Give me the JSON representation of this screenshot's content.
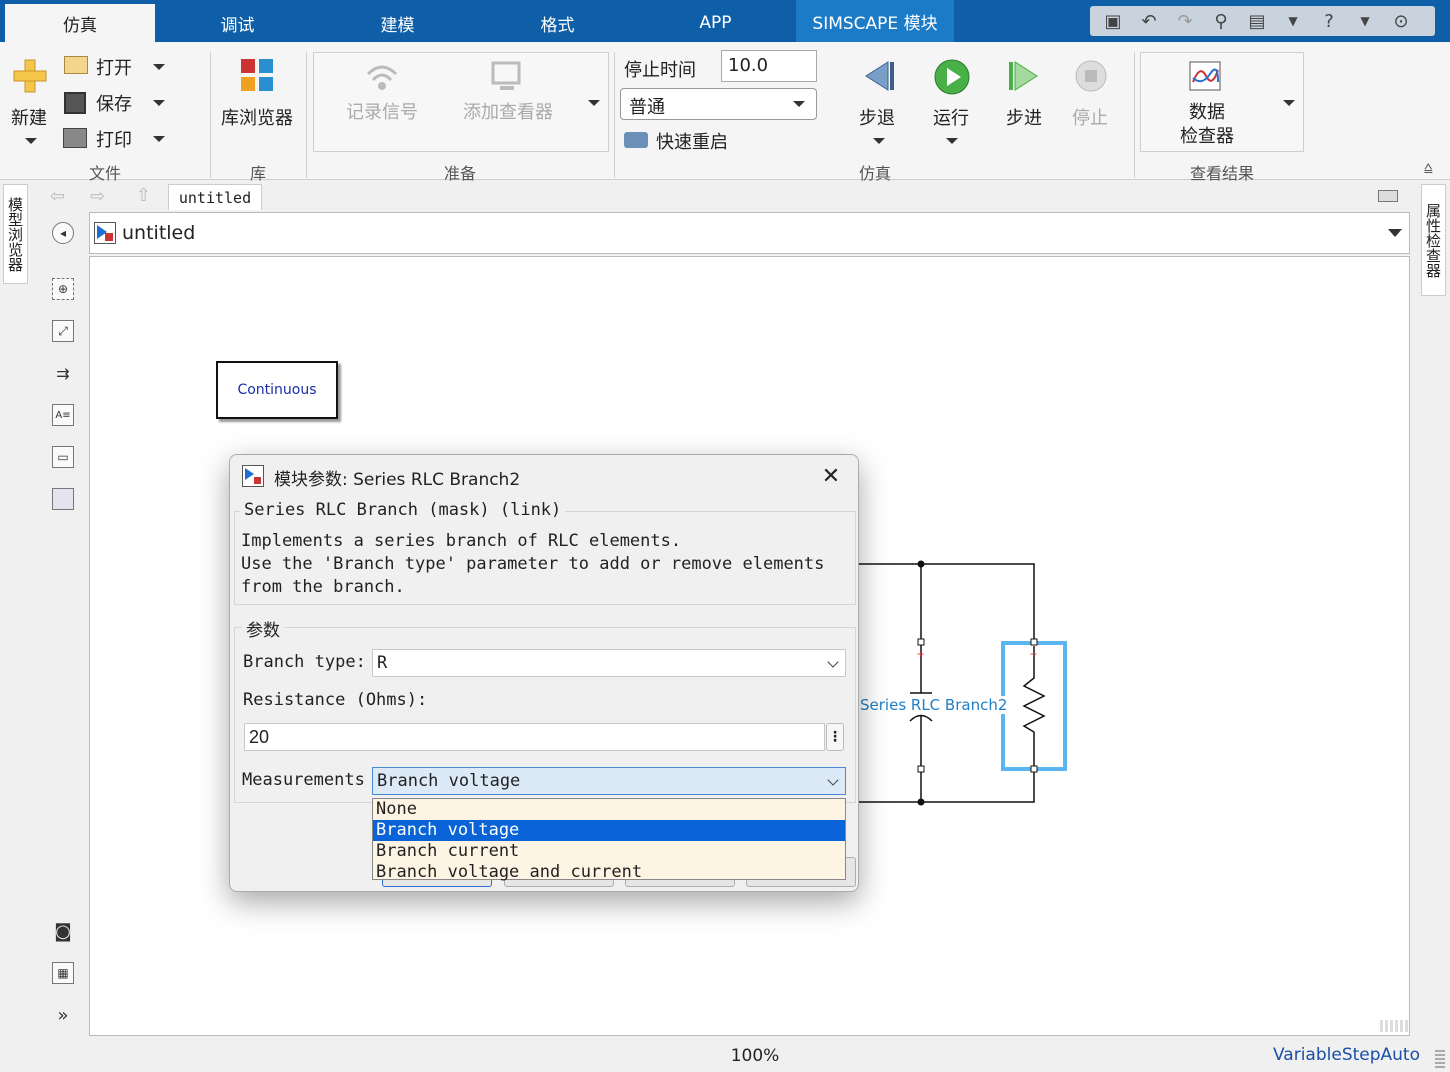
{
  "tabs": [
    "仿真",
    "调试",
    "建模",
    "格式",
    "APP",
    "SIMSCAPE 模块"
  ],
  "ribbon": {
    "file": {
      "new": "新建",
      "open": "打开",
      "save": "保存",
      "print": "打印",
      "group": "文件"
    },
    "library": {
      "browser": "库浏览器",
      "group": "库"
    },
    "prepare": {
      "log_signals": "记录信号",
      "add_viewer": "添加查看器",
      "group": "准备"
    },
    "simulation": {
      "stop_time_label": "停止时间",
      "stop_time_value": "10.0",
      "mode": "普通",
      "fast_restart": "快速重启",
      "step_back": "步退",
      "run": "运行",
      "step_forward": "步进",
      "stop": "停止",
      "group": "仿真"
    },
    "review": {
      "data_inspector_line1": "数据",
      "data_inspector_line2": "检查器",
      "group": "查看结果"
    }
  },
  "side": {
    "model_browser": "模型浏览器",
    "property_inspector": "属性检查器"
  },
  "model_tab": "untitled",
  "address": "untitled",
  "canvas": {
    "continuous": "Continuous",
    "block_label": "Series RLC Branch2"
  },
  "status": {
    "zoom": "100%",
    "solver": "VariableStepAuto"
  },
  "dialog": {
    "title": "模块参数: Series RLC Branch2",
    "mask_header": "Series RLC Branch (mask) (link)",
    "desc1": "Implements a series branch of RLC elements.",
    "desc2": "Use the 'Branch type' parameter to add or remove elements",
    "desc3": "from the branch.",
    "params_header": "参数",
    "branch_type_label": "Branch type:",
    "branch_type_value": "R",
    "resistance_label": "Resistance (Ohms):",
    "resistance_value": "20",
    "measurements_label": "Measurements",
    "measurements_value": "Branch voltage",
    "options": [
      "None",
      "Branch voltage",
      "Branch current",
      "Branch voltage and current"
    ]
  }
}
